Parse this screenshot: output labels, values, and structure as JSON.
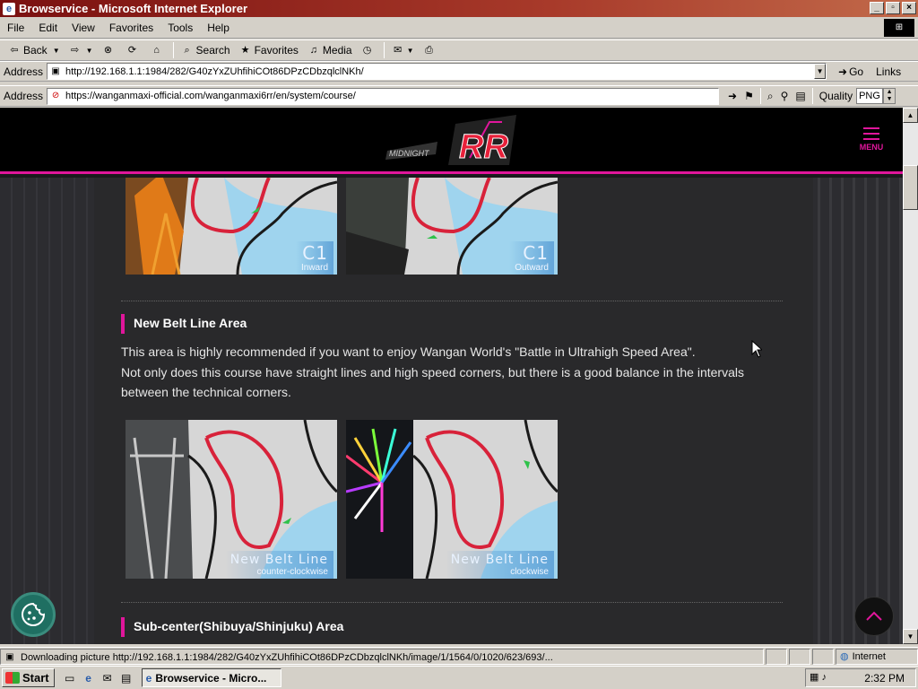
{
  "window": {
    "title": "Browservice - Microsoft Internet Explorer",
    "controls": {
      "minimize": "_",
      "maximize": "▫",
      "close": "×"
    }
  },
  "menu": [
    "File",
    "Edit",
    "View",
    "Favorites",
    "Tools",
    "Help"
  ],
  "toolbar": {
    "back": "Back",
    "search": "Search",
    "favorites": "Favorites",
    "media": "Media"
  },
  "ie_address": {
    "label": "Address",
    "url": "http://192.168.1.1:1984/282/G40zYxZUhfihiCOt86DPzCDbzqlclNKh/",
    "go": "Go",
    "links": "Links"
  },
  "browservice_bar": {
    "label": "Address",
    "url": "https://wanganmaxi-official.com/wanganmaxi6rr/en/system/course/",
    "quality_label": "Quality",
    "quality_value": "PNG"
  },
  "site": {
    "menu_label": "MENU",
    "logo_text": "RR",
    "courses_top": [
      {
        "name": "C1",
        "sub": "Inward"
      },
      {
        "name": "C1",
        "sub": "Outward"
      }
    ],
    "section1": {
      "heading": "New Belt Line Area",
      "line1": "This area is highly recommended if you want to enjoy Wangan World's \"Battle in Ultrahigh Speed Area\".",
      "line2": "Not only does this course have straight lines and high speed corners, but there is a good balance in the intervals",
      "line3": "between the technical corners.",
      "courses": [
        {
          "name": "New Belt Line",
          "sub": "counter-clockwise"
        },
        {
          "name": "New Belt Line",
          "sub": "clockwise"
        }
      ]
    },
    "section2": {
      "heading": "Sub-center(Shibuya/Shinjuku) Area"
    }
  },
  "status": {
    "text": "Downloading picture http://192.168.1.1:1984/282/G40zYxZUhfihiCOt86DPzCDbzqlclNKh/image/1/1564/0/1020/623/693/...",
    "zone": "Internet"
  },
  "taskbar": {
    "start": "Start",
    "task": "Browservice - Micro...",
    "clock": "2:32 PM"
  },
  "colors": {
    "accent": "#e0169b",
    "title_gradient_start": "#7a1010"
  }
}
